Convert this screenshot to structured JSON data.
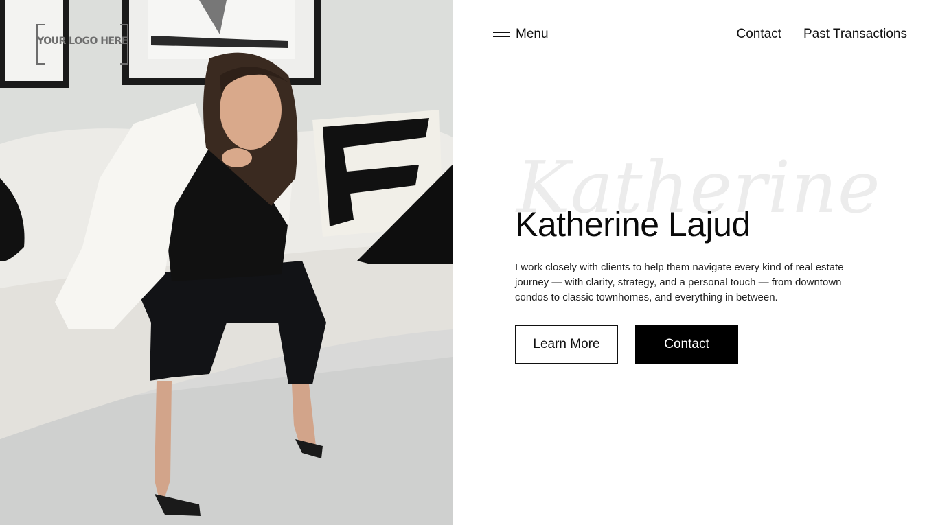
{
  "logo": {
    "text": "YOUR LOGO HERE"
  },
  "header": {
    "menu_label": "Menu",
    "nav": [
      {
        "label": "Contact"
      },
      {
        "label": "Past Transactions"
      }
    ]
  },
  "hero": {
    "script_text": "Katherine",
    "title": "Katherine Lajud",
    "description": "I work closely with clients to help them navigate every kind of real estate journey — with clarity, strategy, and a personal touch — from downtown condos to classic townhomes, and everything in between.",
    "primary_button": "Learn More",
    "secondary_button": "Contact"
  },
  "colors": {
    "background": "#ffffff",
    "text": "#111111",
    "accent": "#000000",
    "script_text": "#ececec"
  }
}
